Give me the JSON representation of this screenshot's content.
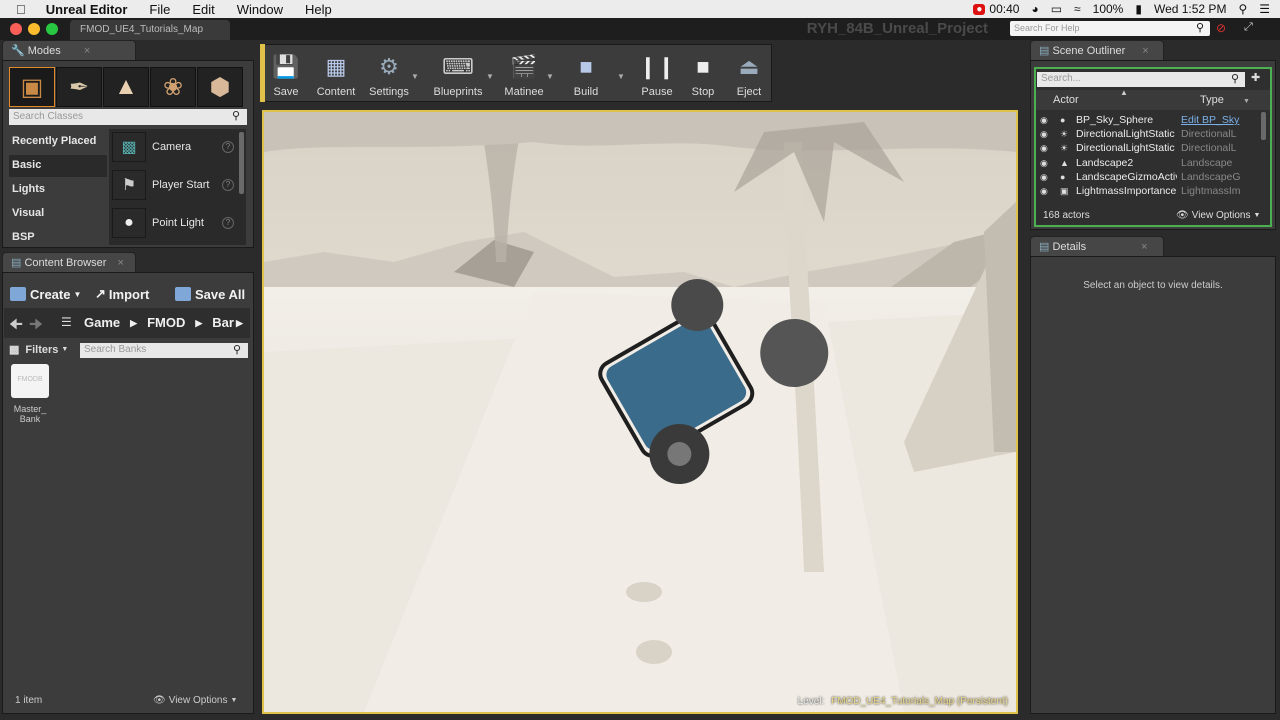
{
  "menubar": {
    "app": "Unreal Editor",
    "items": [
      "File",
      "Edit",
      "Window",
      "Help"
    ],
    "record_time": "00:40",
    "battery": "100%",
    "clock": "Wed 1:52 PM"
  },
  "titlebar": {
    "doc_tab": "FMOD_UE4_Tutorials_Map",
    "project": "RYH_84B_Unreal_Project",
    "help_search_placeholder": "Search For Help"
  },
  "modes": {
    "tab": "Modes",
    "search_placeholder": "Search Classes",
    "categories": [
      "Recently Placed",
      "Basic",
      "Lights",
      "Visual",
      "BSP"
    ],
    "items": [
      {
        "label": "Camera",
        "icon": "camera-icon"
      },
      {
        "label": "Player Start",
        "icon": "player-start-icon"
      },
      {
        "label": "Point Light",
        "icon": "point-light-icon"
      }
    ]
  },
  "content_browser": {
    "tab": "Content Browser",
    "create": "Create",
    "import": "Import",
    "save_all": "Save All",
    "path": [
      "Game",
      "FMOD",
      "Bar"
    ],
    "filters": "Filters",
    "search_placeholder": "Search Banks",
    "asset_thumb": "FMODB",
    "asset_label": "Master_\nBank",
    "count": "1 item",
    "view_options": "View Options"
  },
  "toolbar": {
    "buttons": [
      "Save",
      "Content",
      "Settings",
      "Blueprints",
      "Matinee",
      "Build",
      "Pause",
      "Stop",
      "Eject"
    ]
  },
  "viewport": {
    "level_label": "Level:",
    "level_name": "FMOD_UE4_Tutorials_Map (Persistent)"
  },
  "outliner": {
    "tab": "Scene Outliner",
    "search_placeholder": "Search...",
    "col_actor": "Actor",
    "col_type": "Type",
    "rows": [
      {
        "name": "BP_Sky_Sphere",
        "type": "Edit BP_Sky"
      },
      {
        "name": "DirectionalLightStatic",
        "type": "DirectionalL"
      },
      {
        "name": "DirectionalLightStatic",
        "type": "DirectionalL"
      },
      {
        "name": "Landscape2",
        "type": "Landscape"
      },
      {
        "name": "LandscapeGizmoActive",
        "type": "LandscapeG"
      },
      {
        "name": "LightmassImportance",
        "type": "LightmassIm"
      }
    ],
    "count": "168 actors",
    "view_options": "View Options"
  },
  "details": {
    "tab": "Details",
    "empty_msg": "Select an object to view details."
  }
}
